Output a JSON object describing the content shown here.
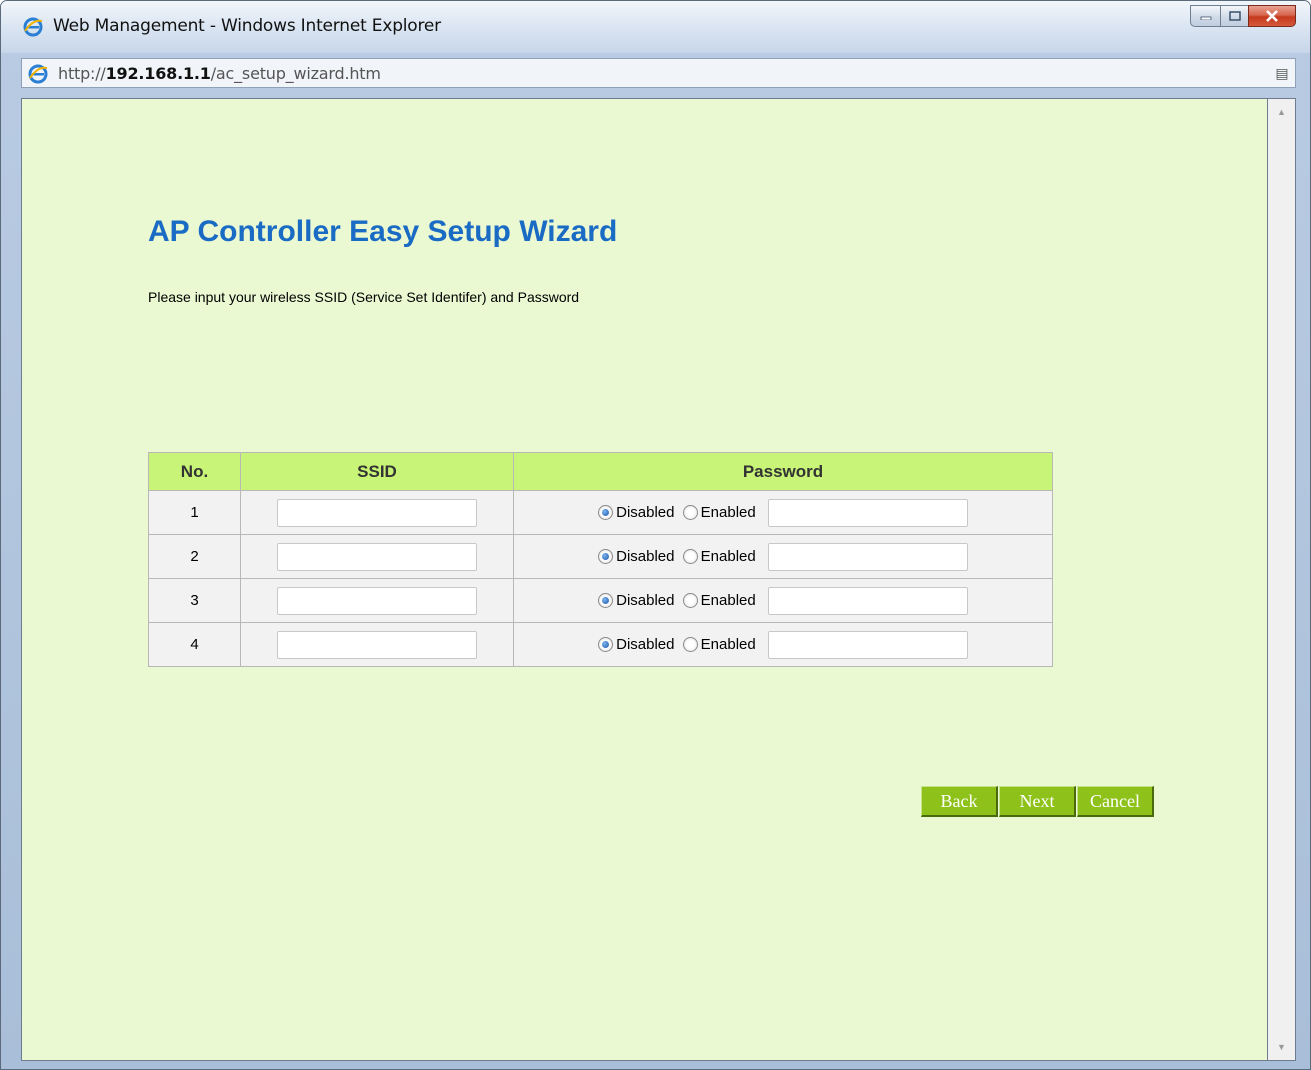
{
  "window": {
    "title": "Web Management - Windows Internet Explorer",
    "address_prefix": "http://",
    "address_host": "192.168.1.1",
    "address_path": "/ac_setup_wizard.htm"
  },
  "page": {
    "title": "AP Controller Easy Setup Wizard",
    "instructions": "Please input your wireless SSID (Service Set Identifer) and Password"
  },
  "table": {
    "headers": {
      "no": "No.",
      "ssid": "SSID",
      "password": "Password"
    },
    "rows": [
      {
        "no": "1",
        "ssid": "",
        "mode": "Disabled",
        "password": ""
      },
      {
        "no": "2",
        "ssid": "",
        "mode": "Disabled",
        "password": ""
      },
      {
        "no": "3",
        "ssid": "",
        "mode": "Disabled",
        "password": ""
      },
      {
        "no": "4",
        "ssid": "",
        "mode": "Disabled",
        "password": ""
      }
    ],
    "disabled_label": "Disabled",
    "enabled_label": "Enabled"
  },
  "buttons": {
    "back": "Back",
    "next": "Next",
    "cancel": "Cancel"
  },
  "colors": {
    "page_bg": "#ebf9d3",
    "title": "#1a6bc4",
    "header_bg": "#c8f577",
    "button_bg": "#8ec21a"
  },
  "icons": [
    "ie-logo-icon",
    "minimize-icon",
    "maximize-icon",
    "close-icon",
    "page-compat-icon",
    "scroll-up-icon",
    "scroll-down-icon"
  ]
}
